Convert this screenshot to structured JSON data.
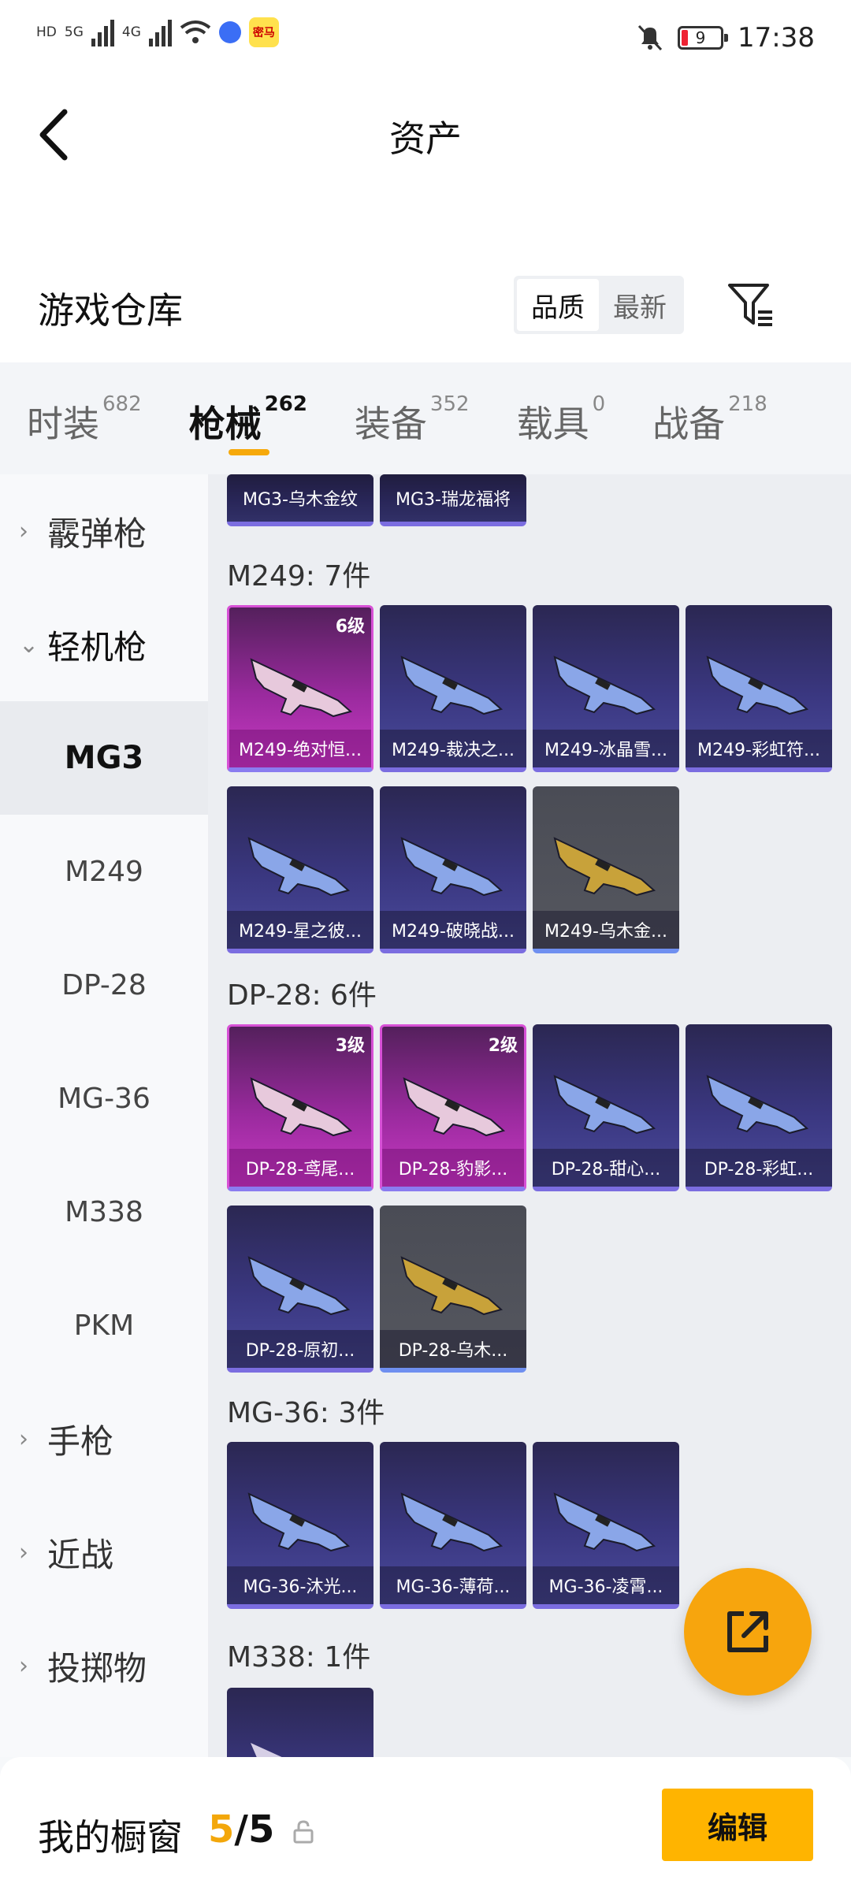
{
  "status_bar": {
    "left_tags": [
      "HD",
      "HD",
      "5G",
      "4G"
    ],
    "app_badge": "密马",
    "battery": "9",
    "time": "17:38"
  },
  "header": {
    "title": "资产"
  },
  "warehouse": {
    "title": "游戏仓库",
    "sort_options": [
      "品质",
      "最新"
    ],
    "active_sort": "品质"
  },
  "tabs": [
    {
      "label": "时装",
      "count": "682"
    },
    {
      "label": "枪械",
      "count": "262",
      "active": true
    },
    {
      "label": "装备",
      "count": "352"
    },
    {
      "label": "载具",
      "count": "0"
    },
    {
      "label": "战备",
      "count": "218"
    }
  ],
  "sidebar": {
    "shotgun": "霰弹枪",
    "lmg": "轻机枪",
    "mg3": "MG3",
    "m249": "M249",
    "dp28": "DP-28",
    "mg36": "MG-36",
    "m338": "M338",
    "pkm": "PKM",
    "pistol": "手枪",
    "melee": "近战",
    "throwable": "投掷物"
  },
  "sections": {
    "mg3_partial": [
      "MG3-乌木金纹",
      "MG3-瑞龙福将"
    ],
    "m249": {
      "heading": "M249: 7件",
      "items": [
        {
          "name": "M249-绝对恒...",
          "level": "6级",
          "rarity": "pink"
        },
        {
          "name": "M249-裁决之...",
          "rarity": "purple"
        },
        {
          "name": "M249-冰晶雪...",
          "rarity": "purple"
        },
        {
          "name": "M249-彩虹符...",
          "rarity": "purple"
        },
        {
          "name": "M249-星之彼...",
          "rarity": "purple"
        },
        {
          "name": "M249-破晓战...",
          "rarity": "purple"
        },
        {
          "name": "M249-乌木金...",
          "rarity": "gray"
        }
      ]
    },
    "dp28": {
      "heading": "DP-28: 6件",
      "items": [
        {
          "name": "DP-28-鸢尾...",
          "level": "3级",
          "rarity": "pink"
        },
        {
          "name": "DP-28-豹影...",
          "level": "2级",
          "rarity": "pink"
        },
        {
          "name": "DP-28-甜心...",
          "rarity": "purple"
        },
        {
          "name": "DP-28-彩虹...",
          "rarity": "purple"
        },
        {
          "name": "DP-28-原初...",
          "rarity": "purple"
        },
        {
          "name": "DP-28-乌木...",
          "rarity": "gray"
        }
      ]
    },
    "mg36": {
      "heading": "MG-36: 3件",
      "items": [
        {
          "name": "MG-36-沐光...",
          "rarity": "purple"
        },
        {
          "name": "MG-36-薄荷...",
          "rarity": "purple"
        },
        {
          "name": "MG-36-凌霄...",
          "rarity": "purple"
        }
      ]
    },
    "m338": {
      "heading": "M338: 1件"
    }
  },
  "footer": {
    "label": "我的橱窗",
    "count_current": "5",
    "count_sep": "/",
    "count_total": "5",
    "edit_label": "编辑"
  }
}
